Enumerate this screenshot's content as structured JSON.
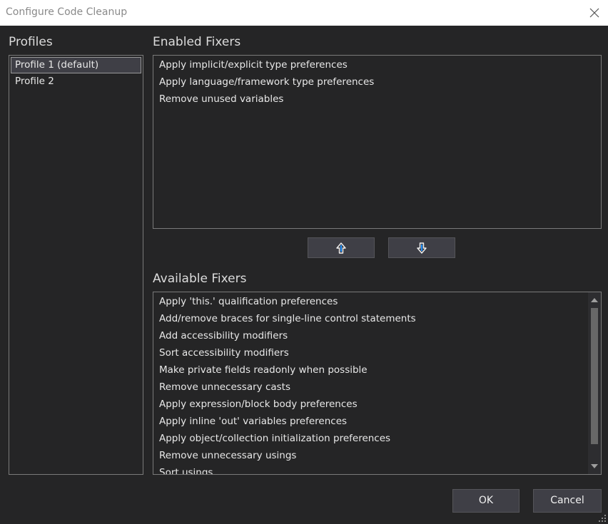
{
  "window": {
    "title": "Configure Code Cleanup",
    "close_icon": "close-icon"
  },
  "profiles": {
    "label": "Profiles",
    "items": [
      {
        "label": "Profile 1 (default)",
        "selected": true
      },
      {
        "label": "Profile 2",
        "selected": false
      }
    ]
  },
  "enabled_fixers": {
    "label": "Enabled Fixers",
    "items": [
      {
        "label": "Apply implicit/explicit type preferences"
      },
      {
        "label": "Apply language/framework type preferences"
      },
      {
        "label": "Remove unused variables"
      }
    ]
  },
  "move_buttons": {
    "up_icon": "arrow-up-icon",
    "down_icon": "arrow-down-icon"
  },
  "available_fixers": {
    "label": "Available Fixers",
    "items": [
      {
        "label": "Apply 'this.' qualification preferences"
      },
      {
        "label": "Add/remove braces for single-line control statements"
      },
      {
        "label": "Add accessibility modifiers"
      },
      {
        "label": "Sort accessibility modifiers"
      },
      {
        "label": "Make private fields readonly when possible"
      },
      {
        "label": "Remove unnecessary casts"
      },
      {
        "label": "Apply expression/block body preferences"
      },
      {
        "label": "Apply inline 'out' variables preferences"
      },
      {
        "label": "Apply object/collection initialization preferences"
      },
      {
        "label": "Remove unnecessary usings"
      },
      {
        "label": "Sort usings"
      }
    ]
  },
  "footer": {
    "ok_label": "OK",
    "cancel_label": "Cancel"
  },
  "colors": {
    "background": "#252526",
    "titlebar": "#ffffff",
    "button": "#3f3f46",
    "border": "#7a7a7a",
    "text": "#e8e8e8",
    "arrow_accent": "#1e90ff"
  }
}
